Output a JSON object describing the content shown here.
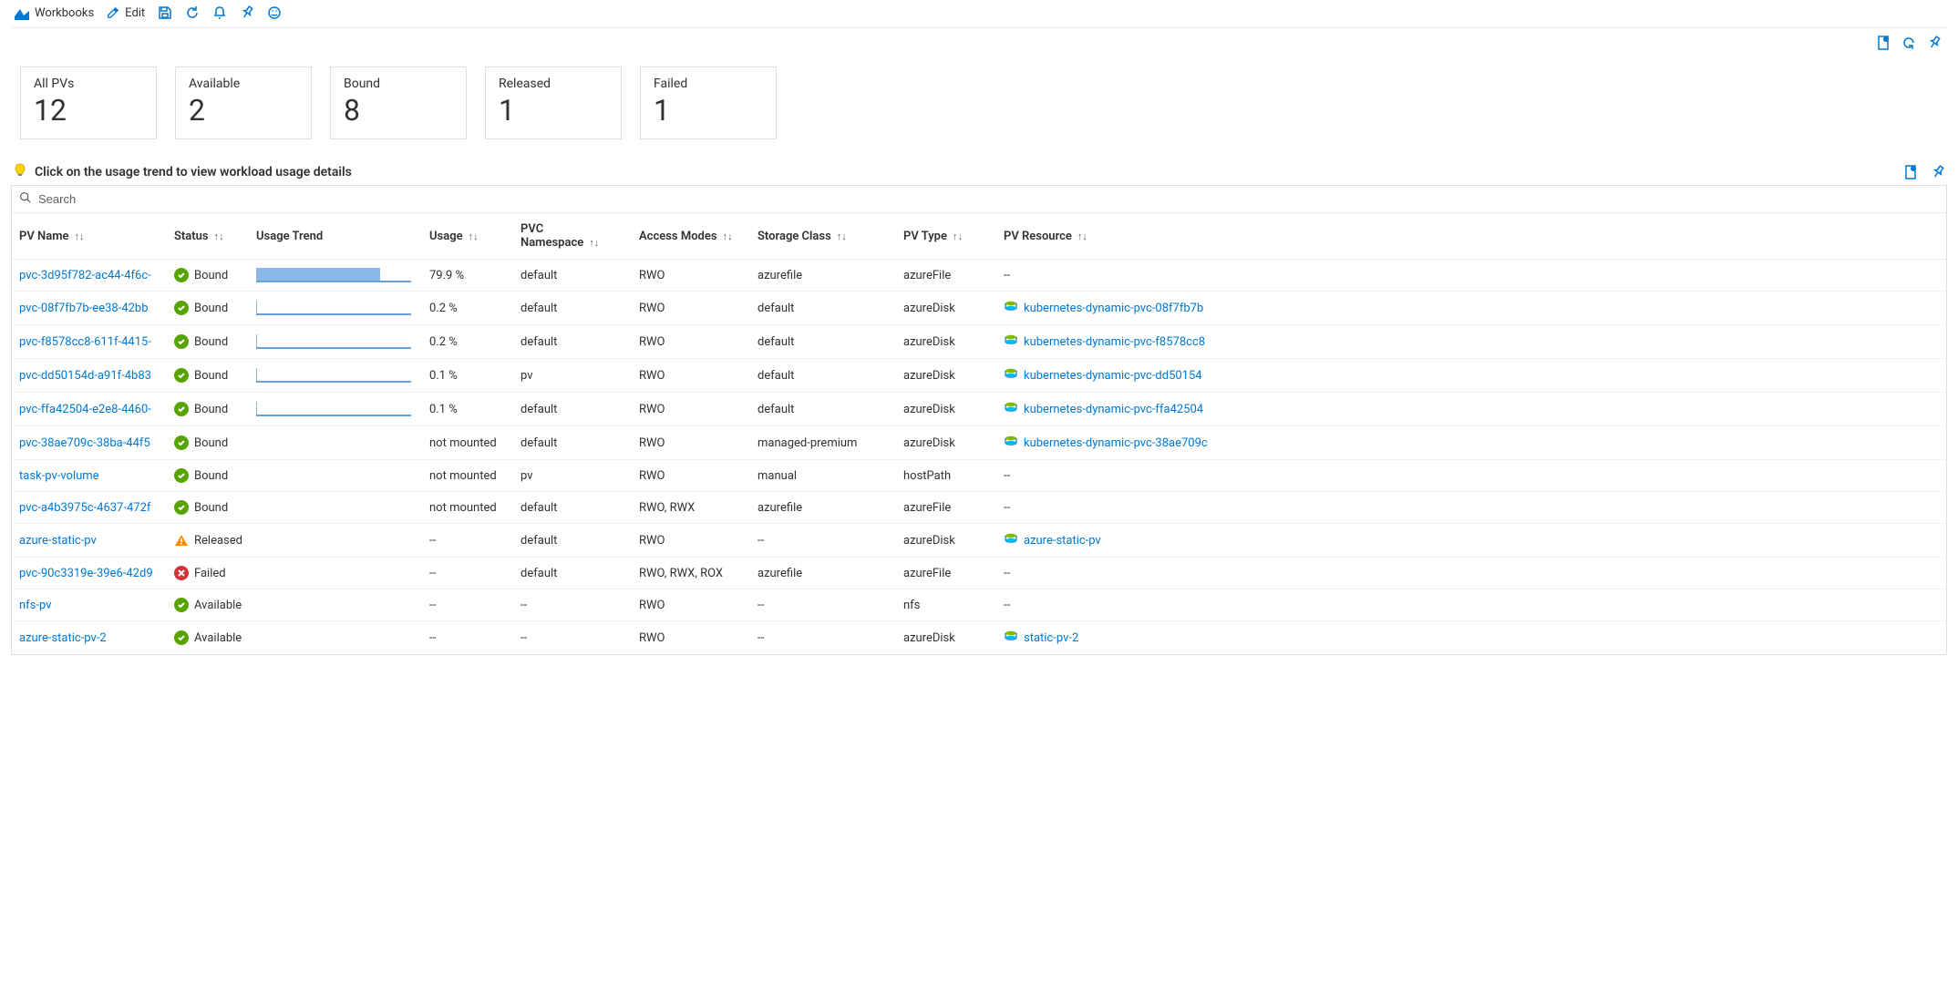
{
  "toolbar": {
    "workbooks": "Workbooks",
    "edit": "Edit"
  },
  "tiles": [
    {
      "label": "All PVs",
      "value": "12"
    },
    {
      "label": "Available",
      "value": "2"
    },
    {
      "label": "Bound",
      "value": "8"
    },
    {
      "label": "Released",
      "value": "1"
    },
    {
      "label": "Failed",
      "value": "1"
    }
  ],
  "hint": "Click on the usage trend to view workload usage details",
  "search": {
    "placeholder": "Search"
  },
  "columns": {
    "name": "PV Name",
    "status": "Status",
    "trend": "Usage Trend",
    "usage": "Usage",
    "ns": "PVC Namespace",
    "am": "Access Modes",
    "sc": "Storage Class",
    "type": "PV Type",
    "res": "PV Resource"
  },
  "rows": [
    {
      "name": "pvc-3d95f782-ac44-4f6c-",
      "status": "Bound",
      "statusKind": "ok",
      "trendPct": 80,
      "usage": "79.9 %",
      "ns": "default",
      "am": "RWO",
      "sc": "azurefile",
      "type": "azureFile",
      "res": "--",
      "resIcon": false
    },
    {
      "name": "pvc-08f7fb7b-ee38-42bb",
      "status": "Bound",
      "statusKind": "ok",
      "trendPct": 0.2,
      "usage": "0.2 %",
      "ns": "default",
      "am": "RWO",
      "sc": "default",
      "type": "azureDisk",
      "res": "kubernetes-dynamic-pvc-08f7fb7b",
      "resIcon": true
    },
    {
      "name": "pvc-f8578cc8-611f-4415-",
      "status": "Bound",
      "statusKind": "ok",
      "trendPct": 0.2,
      "usage": "0.2 %",
      "ns": "default",
      "am": "RWO",
      "sc": "default",
      "type": "azureDisk",
      "res": "kubernetes-dynamic-pvc-f8578cc8",
      "resIcon": true
    },
    {
      "name": "pvc-dd50154d-a91f-4b83",
      "status": "Bound",
      "statusKind": "ok",
      "trendPct": 0.1,
      "usage": "0.1 %",
      "ns": "pv",
      "am": "RWO",
      "sc": "default",
      "type": "azureDisk",
      "res": "kubernetes-dynamic-pvc-dd50154",
      "resIcon": true
    },
    {
      "name": "pvc-ffa42504-e2e8-4460-",
      "status": "Bound",
      "statusKind": "ok",
      "trendPct": 0.1,
      "usage": "0.1 %",
      "ns": "default",
      "am": "RWO",
      "sc": "default",
      "type": "azureDisk",
      "res": "kubernetes-dynamic-pvc-ffa42504",
      "resIcon": true
    },
    {
      "name": "pvc-38ae709c-38ba-44f5",
      "status": "Bound",
      "statusKind": "ok",
      "trendPct": null,
      "usage": "not mounted",
      "ns": "default",
      "am": "RWO",
      "sc": "managed-premium",
      "type": "azureDisk",
      "res": "kubernetes-dynamic-pvc-38ae709c",
      "resIcon": true
    },
    {
      "name": "task-pv-volume",
      "status": "Bound",
      "statusKind": "ok",
      "trendPct": null,
      "usage": "not mounted",
      "ns": "pv",
      "am": "RWO",
      "sc": "manual",
      "type": "hostPath",
      "res": "--",
      "resIcon": false
    },
    {
      "name": "pvc-a4b3975c-4637-472f",
      "status": "Bound",
      "statusKind": "ok",
      "trendPct": null,
      "usage": "not mounted",
      "ns": "default",
      "am": "RWO, RWX",
      "sc": "azurefile",
      "type": "azureFile",
      "res": "--",
      "resIcon": false
    },
    {
      "name": "azure-static-pv",
      "status": "Released",
      "statusKind": "warn",
      "trendPct": null,
      "usage": "--",
      "ns": "default",
      "am": "RWO",
      "sc": "--",
      "type": "azureDisk",
      "res": "azure-static-pv",
      "resIcon": true
    },
    {
      "name": "pvc-90c3319e-39e6-42d9",
      "status": "Failed",
      "statusKind": "fail",
      "trendPct": null,
      "usage": "--",
      "ns": "default",
      "am": "RWO, RWX, ROX",
      "sc": "azurefile",
      "type": "azureFile",
      "res": "--",
      "resIcon": false
    },
    {
      "name": "nfs-pv",
      "status": "Available",
      "statusKind": "ok",
      "trendPct": null,
      "usage": "--",
      "ns": "--",
      "am": "RWO",
      "sc": "--",
      "type": "nfs",
      "res": "--",
      "resIcon": false
    },
    {
      "name": "azure-static-pv-2",
      "status": "Available",
      "statusKind": "ok",
      "trendPct": null,
      "usage": "--",
      "ns": "--",
      "am": "RWO",
      "sc": "--",
      "type": "azureDisk",
      "res": "static-pv-2",
      "resIcon": true
    }
  ]
}
